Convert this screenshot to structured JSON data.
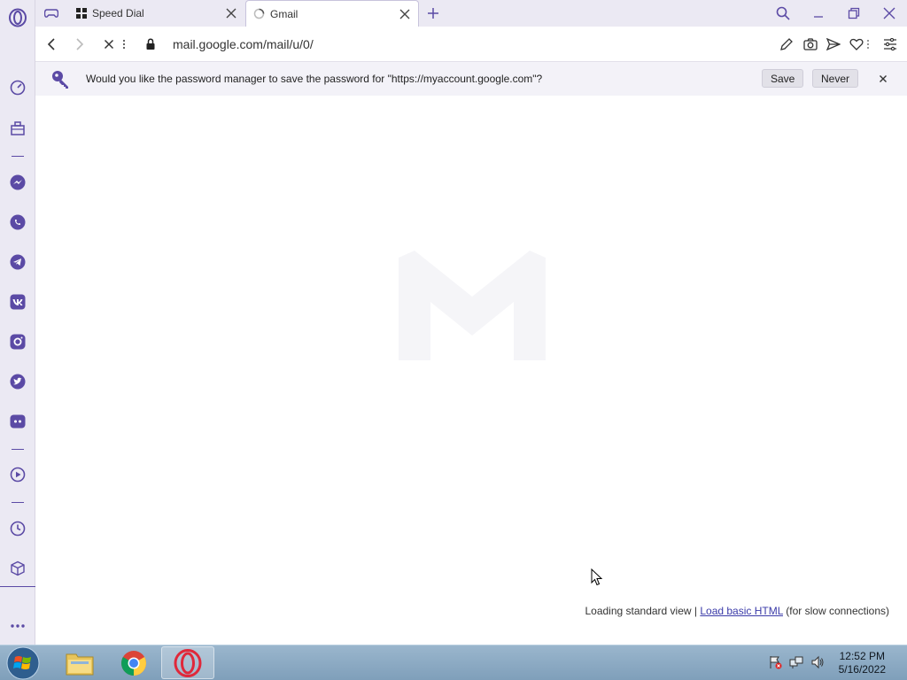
{
  "tabs": [
    {
      "label": "Speed Dial",
      "icon": "speed-dial-icon"
    },
    {
      "label": "Gmail",
      "icon": "loading-spinner-icon"
    }
  ],
  "address": {
    "url": "mail.google.com/mail/u/0/"
  },
  "password_bar": {
    "message": "Would you like the password manager to save the password for \"https://myaccount.google.com\"?",
    "save_label": "Save",
    "never_label": "Never"
  },
  "content": {
    "loading_prefix": "Loading standard view | ",
    "basic_html_link": "Load basic HTML",
    "loading_suffix": " (for slow connections)"
  },
  "sidebar": {
    "items": [
      "speedometer-icon",
      "briefcase-icon",
      "messenger-icon",
      "whatsapp-icon",
      "telegram-icon",
      "vk-icon",
      "instagram-icon",
      "twitter-icon",
      "discord-icon",
      "player-icon",
      "history-icon",
      "box-icon",
      "more-icon"
    ]
  },
  "taskbar": {
    "time": "12:52 PM",
    "date": "5/16/2022"
  },
  "colors": {
    "accent": "#5b4aa5",
    "background": "#ebe9f3"
  }
}
